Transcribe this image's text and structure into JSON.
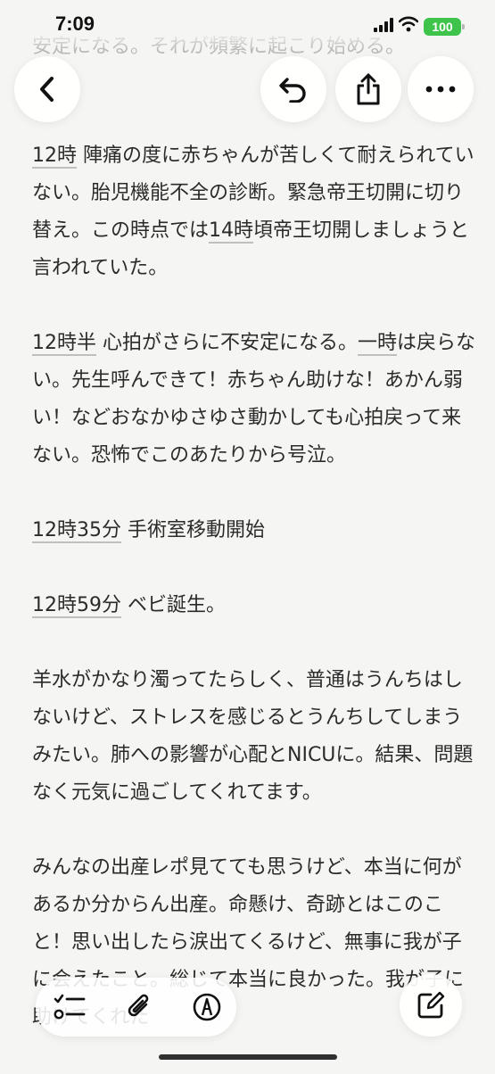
{
  "status": {
    "time": "7:09",
    "battery": "100"
  },
  "note": {
    "top_faded": "〜と言われ、横向きになると、赤ちゃん心拍が不安定になる。それが頻繁に起こり始める。",
    "p1": {
      "time": "12時",
      "text": " 陣痛の度に赤ちゃんが苦しくて耐えられていない。胎児機能不全の診断。緊急帝王切開に切り替え。この時点では",
      "time2": "14時",
      "text2": "頃帝王切開しましょうと言われていた。"
    },
    "p2": {
      "time": "12時半",
      "text": " 心拍がさらに不安定になる。",
      "time2": "一時",
      "text2": "は戻らない。先生呼んできて！赤ちゃん助けな！あかん弱い！などおなかゆさゆさ動かしても心拍戻って来ない。恐怖でこのあたりから号泣。"
    },
    "p3": {
      "time": "12時35分",
      "text": " 手術室移動開始"
    },
    "p4": {
      "time": "12時59分",
      "text": " ベビ誕生。"
    },
    "p5": "羊水がかなり濁ってたらしく、普通はうんちはしないけど、ストレスを感じるとうんちしてしまうみたい。肺への影響が心配とNICUに。結果、問題なく元気に過ごしてくれてます。",
    "p6": "みんなの出産レポ見てても思うけど、本当に何があるか分からん出産。命懸け、奇跡とはこのこと！思い出したら涙出てくるけど、無事に我が子に会えたこと。総じて本当に良かった。我が子に助けてくれた"
  },
  "icons": {
    "back": "chevron-left-icon",
    "undo": "undo-icon",
    "share": "share-icon",
    "more": "more-icon",
    "checklist": "checklist-icon",
    "attach": "paperclip-icon",
    "markup": "pen-markup-icon",
    "compose": "compose-icon"
  },
  "colors": {
    "battery": "#3ec44b",
    "text": "#2b2b2b"
  }
}
